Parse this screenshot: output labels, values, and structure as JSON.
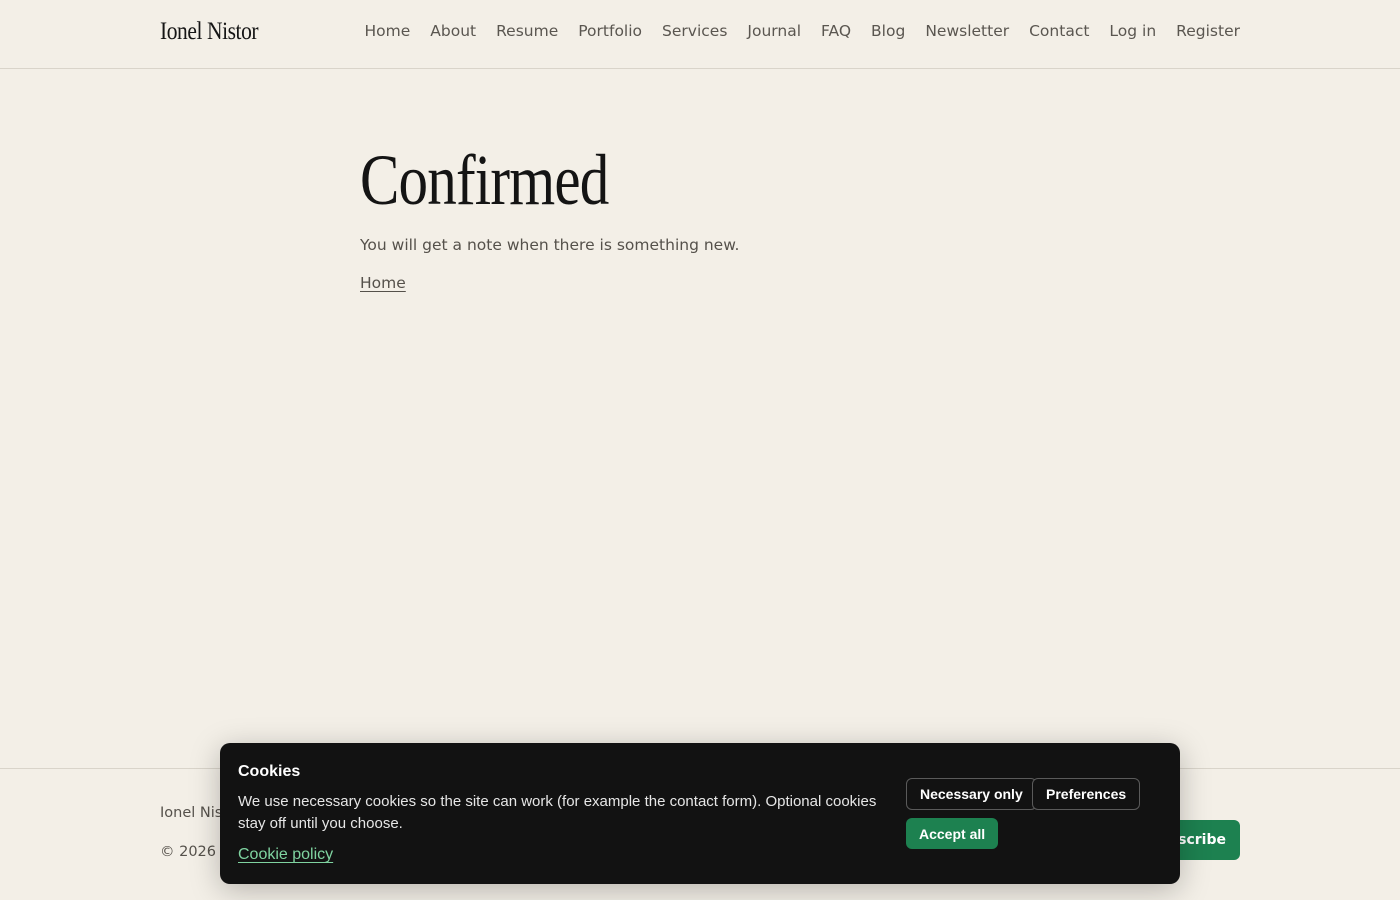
{
  "header": {
    "brand": "Ionel Nistor",
    "nav": [
      "Home",
      "About",
      "Resume",
      "Portfolio",
      "Services",
      "Journal",
      "FAQ",
      "Blog",
      "Newsletter",
      "Contact",
      "Log in",
      "Register"
    ]
  },
  "main": {
    "title": "Confirmed",
    "message": "You will get a note when there is something new.",
    "home_link": "Home"
  },
  "footer": {
    "name": "Ionel Nistor",
    "copyright": "© 2026 –",
    "subscribe_label": "Subscribe"
  },
  "cookie_banner": {
    "title": "Cookies",
    "text": "We use necessary cookies so the site can work (for example the contact form). Optional cookies stay off until you choose.",
    "policy_link": "Cookie policy",
    "necessary_label": "Necessary only",
    "preferences_label": "Preferences",
    "accept_label": "Accept all"
  },
  "colors": {
    "background": "#f3efe7",
    "accent_green": "#1d8150",
    "banner_bg": "#121212",
    "link_green": "#7fd3a0"
  }
}
